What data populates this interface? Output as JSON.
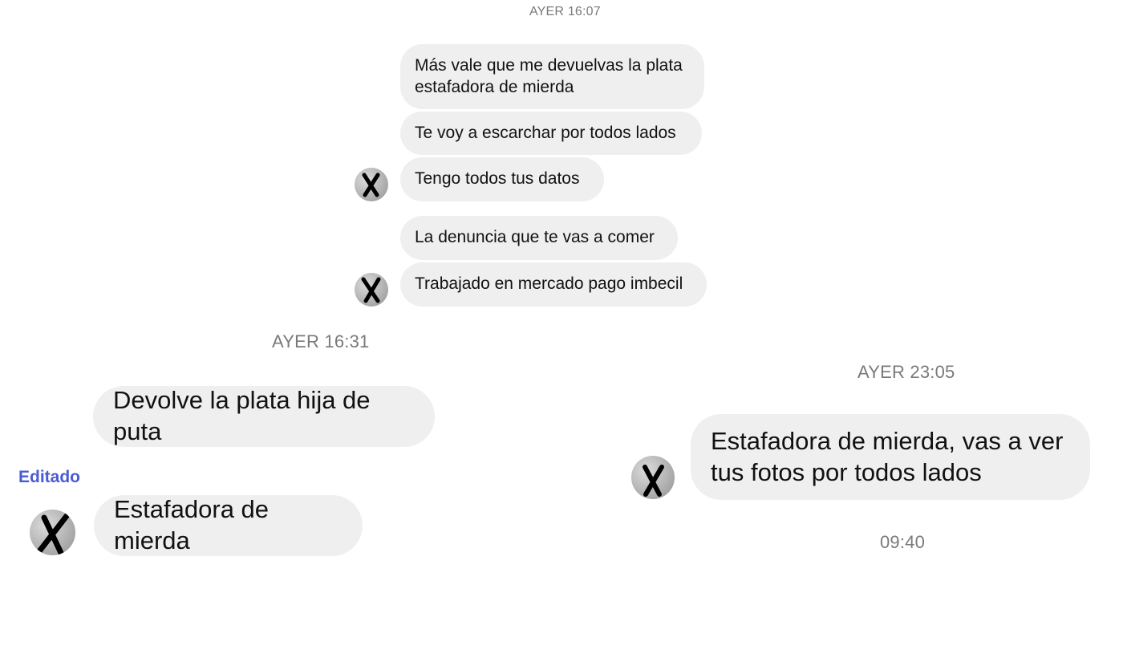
{
  "timestamps": {
    "t1": "AYER 16:07",
    "t2": "AYER 16:31",
    "t3": "AYER 23:05",
    "t4": "09:40"
  },
  "group1": {
    "messages": [
      "Más vale que me devuelvas la plata estafadora de mierda",
      "Te voy a escarchar por todos lados",
      "Tengo todos tus datos"
    ]
  },
  "group2": {
    "messages": [
      "La denuncia que te vas a comer",
      "Trabajado en mercado pago imbecil"
    ]
  },
  "group3": {
    "messages": [
      "Devolve la plata hija de puta",
      "Estafadora de mierda"
    ],
    "edited_label": "Editado"
  },
  "group4": {
    "messages": [
      "Estafadora de mierda, vas a ver tus fotos por todos lados"
    ]
  },
  "colors": {
    "bubble_bg": "#efefef",
    "timestamp": "#7a7a7a",
    "edited": "#4a5bd4"
  },
  "icons": {
    "avatar": "avatar-crossed-out"
  }
}
